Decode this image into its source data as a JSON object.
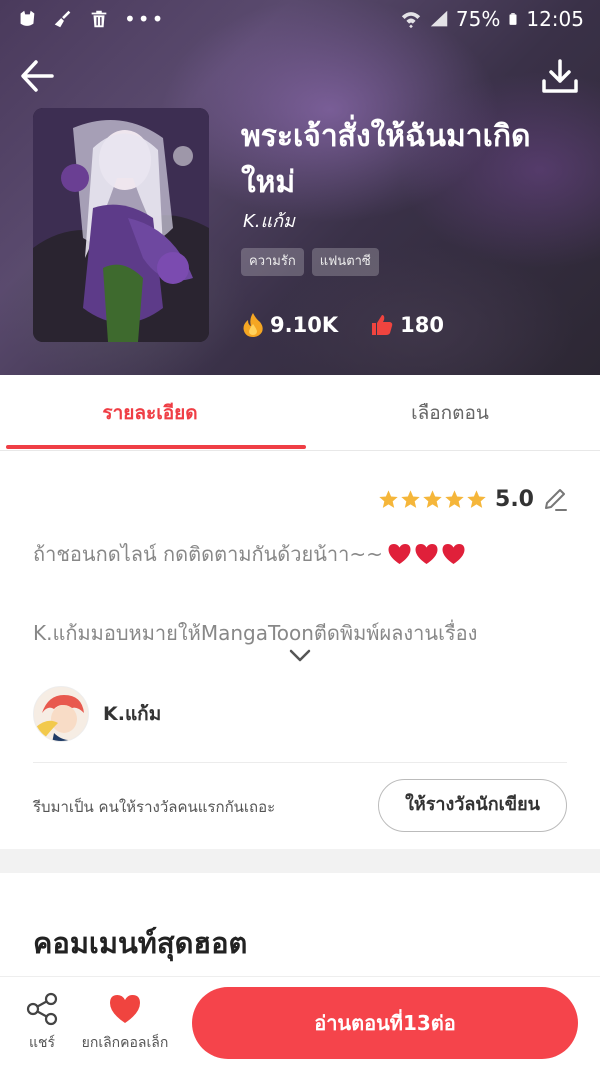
{
  "status_bar": {
    "battery_percent": "75%",
    "time": "12:05",
    "left_icons": [
      "app-notification-icon",
      "broom-icon",
      "trash-icon",
      "more-dots-icon"
    ],
    "right_icons": [
      "wifi-icon",
      "signal-icon",
      "battery-icon"
    ]
  },
  "header": {
    "back_icon": "arrow-left-icon",
    "download_icon": "download-icon",
    "title": "พระเจ้าสั่งให้ฉันมาเกิดใหม่",
    "author": "K.แก้ม",
    "tags": [
      "ความรัก",
      "แฟนตาซี"
    ],
    "views": "9.10K",
    "likes": "180"
  },
  "tabs": {
    "detail": "รายละเอียด",
    "episodes": "เลือกตอน",
    "active": "detail"
  },
  "details": {
    "rating": "5.0",
    "stars": 5,
    "description_line1": "ถ้าชอนกดไลน์  กดติดตามกันด้วยน้าา~~",
    "description_line2": "K.แก้มมอบหมายให้MangaToonตีดพิมพ์ผลงานเรื่อง",
    "author_name": "K.แก้ม",
    "reward_text": "รีบมาเป็น คนให้รางวัลคนแรกกันเถอะ",
    "reward_button": "ให้รางวัลนักเขียน",
    "hot_comments_title": "คอมเมนท์สุดฮอต"
  },
  "bottom_bar": {
    "share_label": "แชร์",
    "collect_label": "ยกเลิกคอลเล็ก",
    "read_button": "อ่านตอนที่13ต่อ"
  },
  "colors": {
    "accent": "#f5444b",
    "tab_active": "#ef3e45",
    "star": "#f5b63a"
  }
}
